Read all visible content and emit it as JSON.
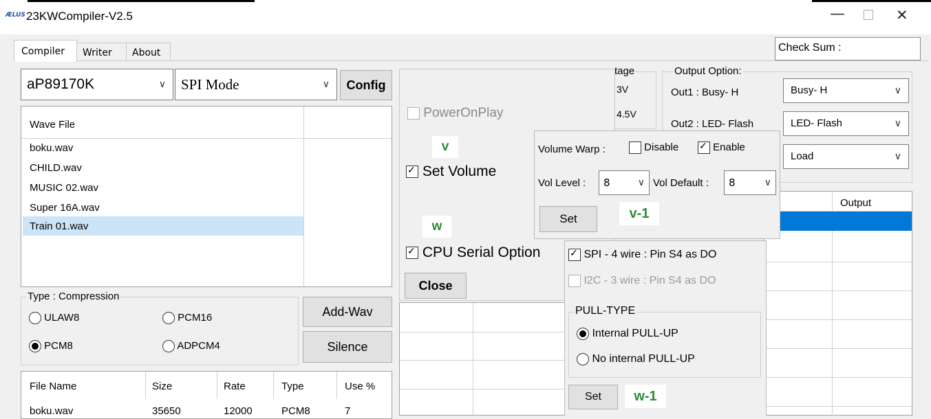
{
  "window": {
    "logo_text": "ÆLUS",
    "title": "23KWCompiler-V2.5",
    "minimize": "—",
    "maximize": "☐",
    "close": "✕"
  },
  "tabs": [
    "Compiler",
    "Writer",
    "About"
  ],
  "checksum_label": "Check Sum :",
  "toolbar": {
    "chip": "aP89170K",
    "mode": "SPI Mode",
    "config": "Config"
  },
  "wave_list": {
    "header": "Wave File",
    "items": [
      "boku.wav",
      "CHILD.wav",
      "MUSIC 02.wav",
      "Super 16A.wav",
      "Train 01.wav"
    ],
    "selected": "Train 01.wav"
  },
  "compression": {
    "legend": "Type : Compression",
    "options": [
      "ULAW8",
      "PCM16",
      "PCM8",
      "ADPCM4"
    ],
    "selected": "PCM8"
  },
  "buttons": {
    "add_wav": "Add-Wav",
    "silence": "Silence",
    "close": "Close",
    "set_volume": "Set",
    "set_pull": "Set"
  },
  "file_table": {
    "headers": [
      "File Name",
      "Size",
      "Rate",
      "Type",
      "Use %"
    ],
    "rows": [
      [
        "boku.wav",
        "35650",
        "12000",
        "PCM8",
        "7"
      ]
    ]
  },
  "options_panel": {
    "power_on_play": "PowerOnPlay",
    "set_volume": "Set Volume",
    "cpu_serial": "CPU Serial Option",
    "label_v": "v",
    "label_w": "w",
    "label_v1": "v-1",
    "label_w1": "w-1"
  },
  "voltage": {
    "legend": "tage",
    "items": [
      "3V",
      "4.5V"
    ]
  },
  "output_option": {
    "legend": "Output Option:",
    "out1_label": "Out1 : Busy- H",
    "out1_value": "Busy- H",
    "out2_label": "Out2 : LED- Flash",
    "out2_value": "LED- Flash",
    "load_value": "Load"
  },
  "right_table": {
    "header_output": "Output"
  },
  "volume_popup": {
    "warp_label": "Volume Warp :",
    "disable": "Disable",
    "enable": "Enable",
    "level_label": "Vol Level :",
    "level_value": "8",
    "default_label": "Vol Default :",
    "default_value": "8"
  },
  "serial_popup": {
    "spi": "SPI - 4 wire : Pin S4 as DO",
    "i2c": "I2C - 3 wire : Pin S4 as DO",
    "pull_legend": "PULL-TYPE",
    "internal": "Internal PULL-UP",
    "no_internal": "No internal PULL-UP"
  }
}
